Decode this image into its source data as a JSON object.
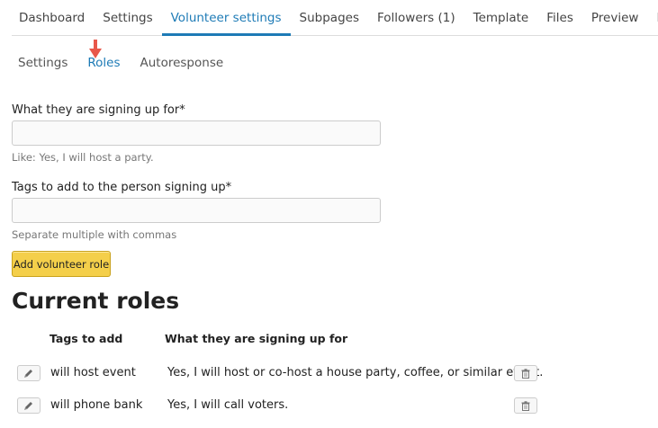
{
  "top_tabs": [
    {
      "label": "Dashboard"
    },
    {
      "label": "Settings"
    },
    {
      "label": "Volunteer settings",
      "active": true
    },
    {
      "label": "Subpages"
    },
    {
      "label": "Followers (1)"
    },
    {
      "label": "Template"
    },
    {
      "label": "Files"
    },
    {
      "label": "Preview"
    },
    {
      "label": "Live"
    }
  ],
  "sub_tabs": [
    {
      "label": "Settings"
    },
    {
      "label": "Roles",
      "active": true
    },
    {
      "label": "Autoresponse"
    }
  ],
  "form": {
    "signup_label": "What they are signing up for*",
    "signup_value": "",
    "signup_hint": "Like: Yes, I will host a party.",
    "tags_label": "Tags to add to the person signing up*",
    "tags_value": "",
    "tags_hint": "Separate multiple with commas",
    "add_button": "Add volunteer role"
  },
  "roles": {
    "title": "Current roles",
    "headers": {
      "tags": "Tags to add",
      "signup": "What they are signing up for"
    },
    "rows": [
      {
        "tags": "will host event",
        "signup": "Yes, I will host or co-host a house party, coffee, or similar event."
      },
      {
        "tags": "will phone bank",
        "signup": "Yes, I will call voters."
      }
    ]
  },
  "colors": {
    "accent": "#1e7bb6",
    "button": "#f4cf4a",
    "arrow": "#e8574a"
  },
  "icons": {
    "edit": "pencil-icon",
    "delete": "trash-icon",
    "pointer": "arrow-down-icon"
  }
}
